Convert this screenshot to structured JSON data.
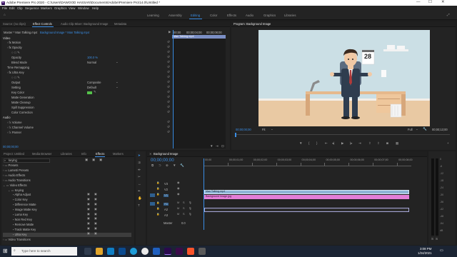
{
  "window": {
    "title": "Adobe Premiere Pro 2020 - C:\\Users\\DAWOOD HASSAN\\Documents\\Adobe\\Premiere Pro\\14.0\\Untitled *",
    "minimize": "—",
    "maximize": "☐",
    "close": "✕",
    "logo": "Pr"
  },
  "menu": [
    "File",
    "Edit",
    "Clip",
    "Sequence",
    "Markers",
    "Graphics",
    "View",
    "Window",
    "Help"
  ],
  "workspaces": [
    "Learning",
    "Assembly",
    "Editing",
    "Color",
    "Effects",
    "Audio",
    "Graphics",
    "Libraries"
  ],
  "active_workspace": "Editing",
  "source_panel": {
    "tabs": [
      "Source: (no clips)",
      "Effect Controls",
      "Audio Clip Mixer: Background Image",
      "Metadata"
    ],
    "active_tab": "Effect Controls",
    "master_label": "Master * Man Talking.mp4",
    "clip_label": "Background Image * Man Talking.mp4",
    "timecodes": [
      "00;00",
      "00;00;04;00",
      "00;00;08;00"
    ],
    "clip_bar": "Man Talking.mp4",
    "video_header": "Video",
    "rows": [
      {
        "label": "Motion",
        "indent": 1,
        "fx": true
      },
      {
        "label": "Opacity",
        "indent": 1,
        "fx": true
      },
      {
        "label": "",
        "indent": 2,
        "icons": true
      },
      {
        "label": "Opacity",
        "indent": 2,
        "value": "100.0 %",
        "value_blue": true
      },
      {
        "label": "Blend Mode",
        "indent": 2,
        "value": "Normal",
        "dropdown": true
      },
      {
        "label": "Time Remapping",
        "indent": 1
      },
      {
        "label": "Ultra Key",
        "indent": 1,
        "fx": true
      },
      {
        "label": "",
        "indent": 2,
        "icons": true
      },
      {
        "label": "Output",
        "indent": 2,
        "value": "Composite",
        "dropdown": true
      },
      {
        "label": "Setting",
        "indent": 2,
        "value": "Default",
        "dropdown": true
      },
      {
        "label": "Key Color",
        "indent": 2,
        "swatch": true
      },
      {
        "label": "Matte Generation",
        "indent": 2
      },
      {
        "label": "Matte Cleanup",
        "indent": 2
      },
      {
        "label": "Spill Suppression",
        "indent": 2
      },
      {
        "label": "Color Correction",
        "indent": 2
      }
    ],
    "audio_header": "Audio",
    "audio_rows": [
      "Volume",
      "Channel Volume",
      "Panner"
    ],
    "bottom_timecode": "00;00;00;00"
  },
  "program": {
    "title": "Program: Background Image",
    "timecode": "00;00;00;00",
    "fit": "Fit",
    "quality": "Full",
    "duration": "00;00;13;00",
    "calendar_number": "28"
  },
  "project_panel": {
    "tabs": [
      "Project: Untitled",
      "Media Browser",
      "Libraries",
      "Info",
      "Effects",
      "Markers"
    ],
    "active_tab": "Effects",
    "search_value": "keying",
    "tree": [
      {
        "label": "Presets",
        "indent": 0
      },
      {
        "label": "Lumetri Presets",
        "indent": 0
      },
      {
        "label": "Audio Effects",
        "indent": 0
      },
      {
        "label": "Audio Transitions",
        "indent": 0
      },
      {
        "label": "Video Effects",
        "indent": 0,
        "open": true
      },
      {
        "label": "Keying",
        "indent": 1,
        "open": true
      },
      {
        "label": "Alpha Adjust",
        "indent": 2
      },
      {
        "label": "Color Key",
        "indent": 2
      },
      {
        "label": "Difference Matte",
        "indent": 2
      },
      {
        "label": "Image Matte Key",
        "indent": 2
      },
      {
        "label": "Luma Key",
        "indent": 2
      },
      {
        "label": "Non Red Key",
        "indent": 2
      },
      {
        "label": "Remove Matte",
        "indent": 2
      },
      {
        "label": "Track Matte Key",
        "indent": 2
      },
      {
        "label": "Ultra Key",
        "indent": 2,
        "selected": true
      },
      {
        "label": "Video Transitions",
        "indent": 0
      }
    ]
  },
  "timeline": {
    "title": "Background Image",
    "timecode": "00;00;00;00",
    "ruler": [
      "00;00",
      "00;00;01;00",
      "00;00;02;00",
      "00;00;03;00",
      "00;00;04;00",
      "00;00;05;00",
      "00;00;06;00",
      "00;00;07;00",
      "00;00;08;00"
    ],
    "video_tracks": [
      "V3",
      "V2",
      "V1"
    ],
    "audio_tracks": [
      "A1",
      "A2",
      "A3"
    ],
    "master": "Master",
    "master_value": "0.0",
    "clips": [
      {
        "track": "V2",
        "label": "Man Talking.mp4",
        "kind": "video"
      },
      {
        "track": "V1",
        "label": "Background Image.jpg",
        "kind": "image"
      }
    ],
    "meter_labels": [
      "0",
      "-6",
      "-12",
      "-18",
      "-24",
      "-30",
      "-36",
      "-42",
      "-48",
      "-54",
      "dB"
    ]
  },
  "taskbar": {
    "search_placeholder": "Type here to search",
    "time": "3:08 PM",
    "date": "1/24/2021"
  }
}
